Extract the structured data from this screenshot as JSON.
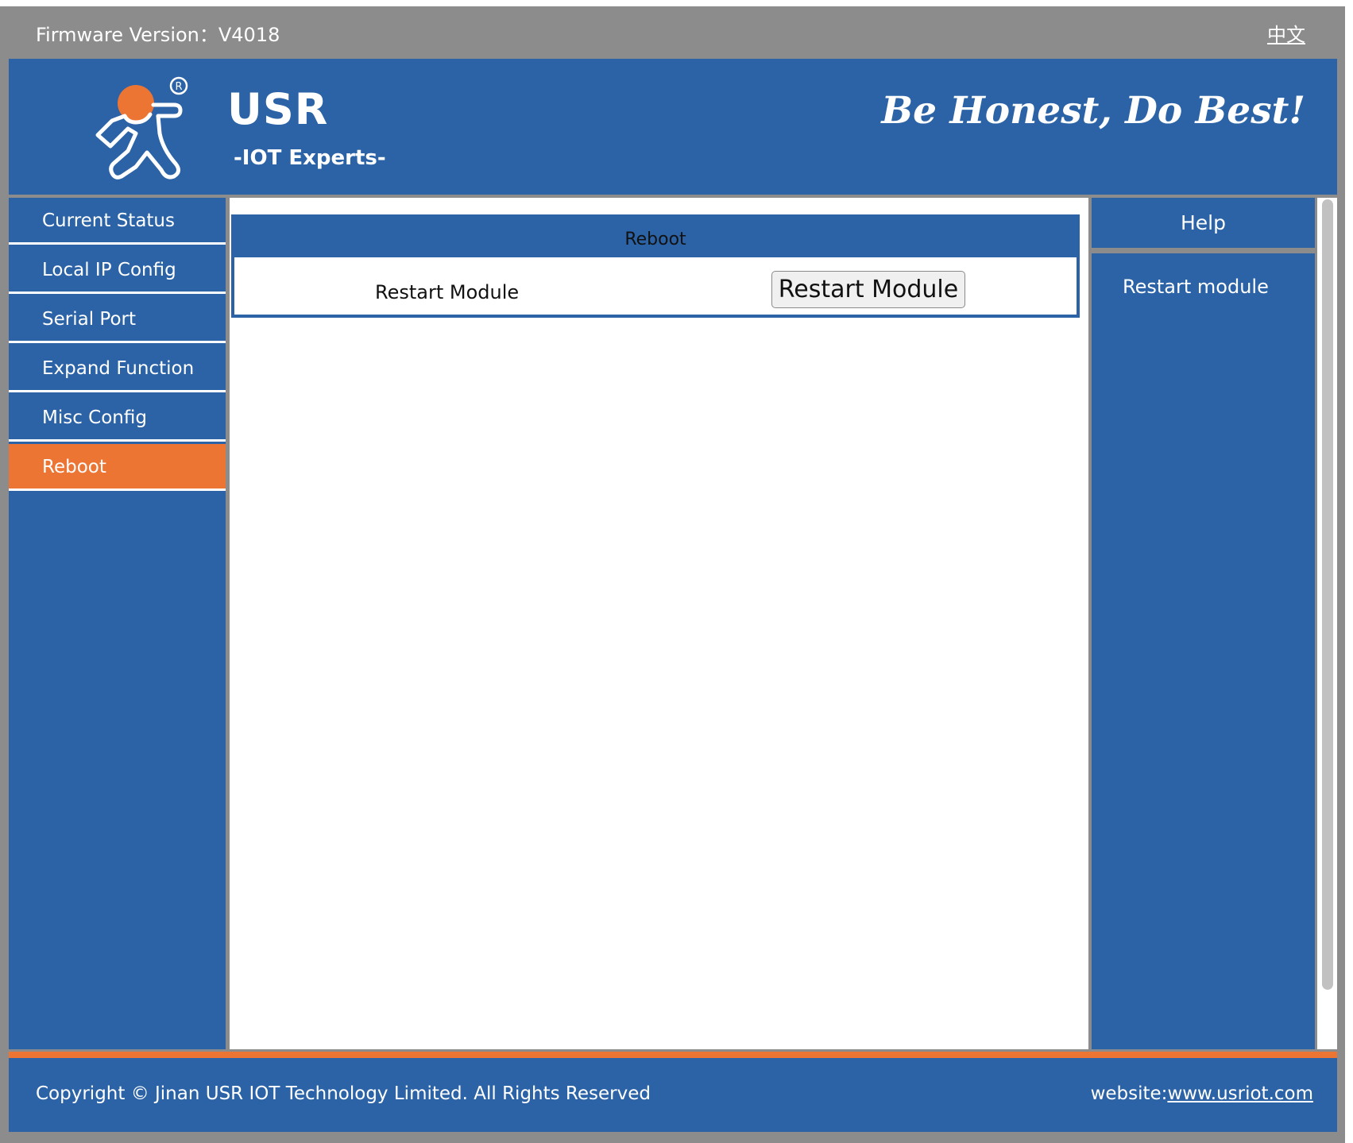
{
  "topbar": {
    "firmware_text": "Firmware Version：V4018",
    "language_link": "中文"
  },
  "header": {
    "brand": "USR",
    "brand_sub": "-IOT Experts-",
    "slogan": "Be Honest, Do Best!"
  },
  "sidebar": {
    "items": [
      {
        "label": "Current Status"
      },
      {
        "label": "Local IP Config"
      },
      {
        "label": "Serial Port"
      },
      {
        "label": "Expand Function"
      },
      {
        "label": "Misc Config"
      },
      {
        "label": "Reboot",
        "active": true
      }
    ]
  },
  "main": {
    "panel_title": "Reboot",
    "row_label": "Restart Module",
    "button_label": "Restart Module"
  },
  "help": {
    "title": "Help",
    "text": "Restart module"
  },
  "footer": {
    "copyright": "Copyright © Jinan USR IOT Technology Limited. All Rights Reserved",
    "website_prefix": "website:",
    "website_link": "www.usriot.com"
  },
  "colors": {
    "primary_blue": "#2b63a6",
    "accent_orange": "#ed7533",
    "topbar_gray": "#8c8c8c"
  }
}
